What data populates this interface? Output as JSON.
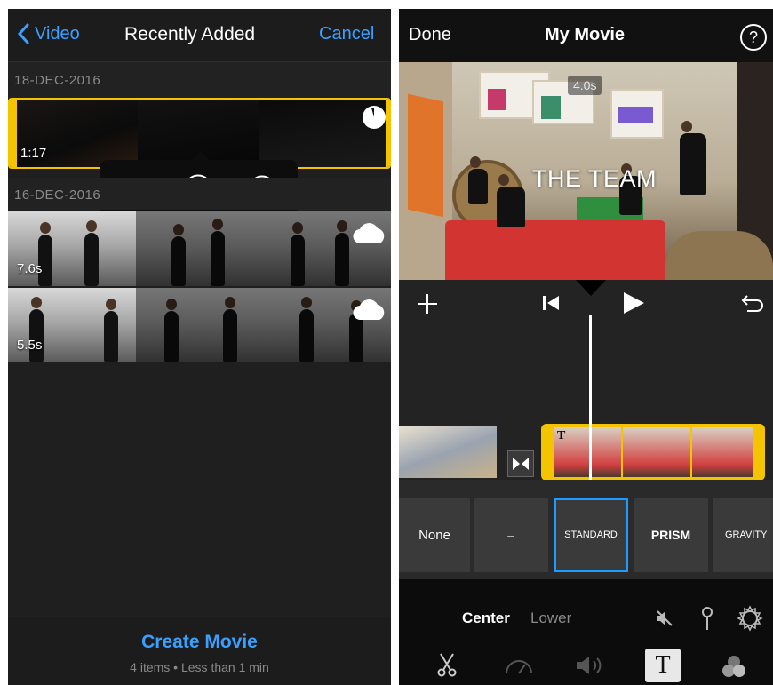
{
  "left": {
    "nav": {
      "back_label": "Video",
      "title": "Recently Added",
      "cancel_label": "Cancel"
    },
    "sections": [
      {
        "date": "18-DEC-2016",
        "clips": [
          {
            "duration": "1:17",
            "selected": true
          }
        ]
      },
      {
        "date": "16-DEC-2016",
        "clips": [
          {
            "duration": "7.6s",
            "icon": "cloud-icon"
          },
          {
            "duration": "5.5s",
            "icon": "cloud-icon"
          }
        ]
      }
    ],
    "popover_actions": [
      "play-icon",
      "checkmark-circle-icon",
      "stop-circle-icon"
    ],
    "footer": {
      "create_label": "Create Movie",
      "summary": "4 items • Less than 1 min"
    }
  },
  "right": {
    "nav": {
      "done_label": "Done",
      "title": "My Movie",
      "help_label": "?"
    },
    "preview": {
      "time_badge": "4.0s",
      "overlay_title": "THE TEAM"
    },
    "toolbar_icons": [
      "plus-icon",
      "skip-back-icon",
      "play-icon",
      "undo-icon"
    ],
    "title_styles": [
      {
        "label": "None"
      },
      {
        "label": "–"
      },
      {
        "label": "STANDARD",
        "selected": true
      },
      {
        "label": "PRISM"
      },
      {
        "label": "GRAVITY"
      }
    ],
    "position": {
      "active": "Center",
      "inactive": "Lower"
    },
    "tools": [
      "scissors-icon",
      "speed-icon",
      "volume-icon",
      "text-icon",
      "filters-icon"
    ],
    "colors": {
      "accent": "#3aa0ff",
      "selection": "#f5c400",
      "style_selected": "#1e9bff"
    }
  }
}
